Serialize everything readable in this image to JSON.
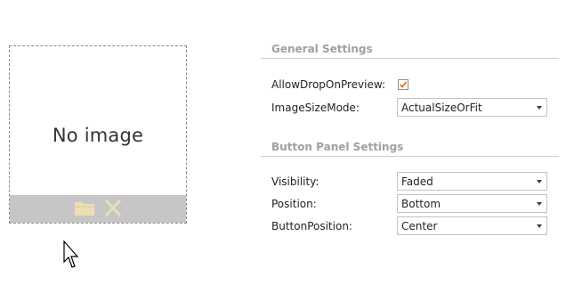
{
  "image_editor": {
    "placeholder_text": "No image",
    "buttons": [
      {
        "icon": "folder-icon",
        "action": "load"
      },
      {
        "icon": "close-icon",
        "action": "clear"
      }
    ]
  },
  "general_settings": {
    "title": "General Settings",
    "allow_drop_label": "AllowDropOnPreview:",
    "allow_drop_checked": true,
    "image_size_mode_label": "ImageSizeMode:",
    "image_size_mode_value": "ActualSizeOrFit"
  },
  "button_panel_settings": {
    "title": "Button Panel Settings",
    "visibility_label": "Visibility:",
    "visibility_value": "Faded",
    "position_label": "Position:",
    "position_value": "Bottom",
    "button_position_label": "ButtonPosition:",
    "button_position_value": "Center"
  },
  "colors": {
    "section_title": "#9aa49a",
    "button_panel_bg": "#c6c6c6",
    "icon_fill": "#ecdfb5",
    "checkmark": "#e07b22"
  }
}
